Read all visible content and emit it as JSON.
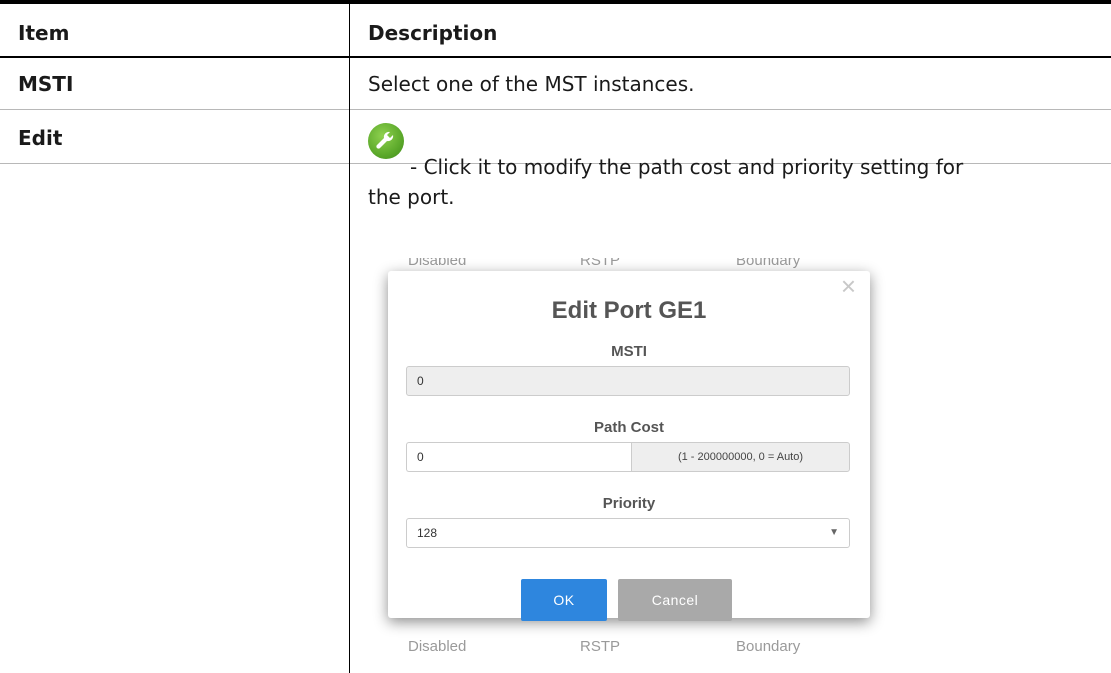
{
  "table": {
    "headers": [
      "Item",
      "Description"
    ],
    "rows": [
      {
        "item": "MSTI",
        "description": "Select one of the MST instances."
      },
      {
        "item": "Edit",
        "description_line1": " - Click it to modify the path cost and priority setting for",
        "description_line2": "the port."
      }
    ]
  },
  "dialog": {
    "title": "Edit Port GE1",
    "close": "×",
    "msti_label": "MSTI",
    "msti_value": "0",
    "path_cost_label": "Path Cost",
    "path_cost_value": "0",
    "path_cost_hint": "(1 - 200000000, 0 = Auto)",
    "priority_label": "Priority",
    "priority_value": "128",
    "ok_label": "OK",
    "cancel_label": "Cancel",
    "background_text": {
      "top": [
        "Disabled",
        "RSTP",
        "Boundary"
      ],
      "bottom": [
        "Disabled",
        "RSTP",
        "Boundary"
      ]
    }
  },
  "colors": {
    "ok_button": "#2e86de",
    "cancel_button": "#a9a9a9",
    "edit_icon": "#5ca92b"
  }
}
